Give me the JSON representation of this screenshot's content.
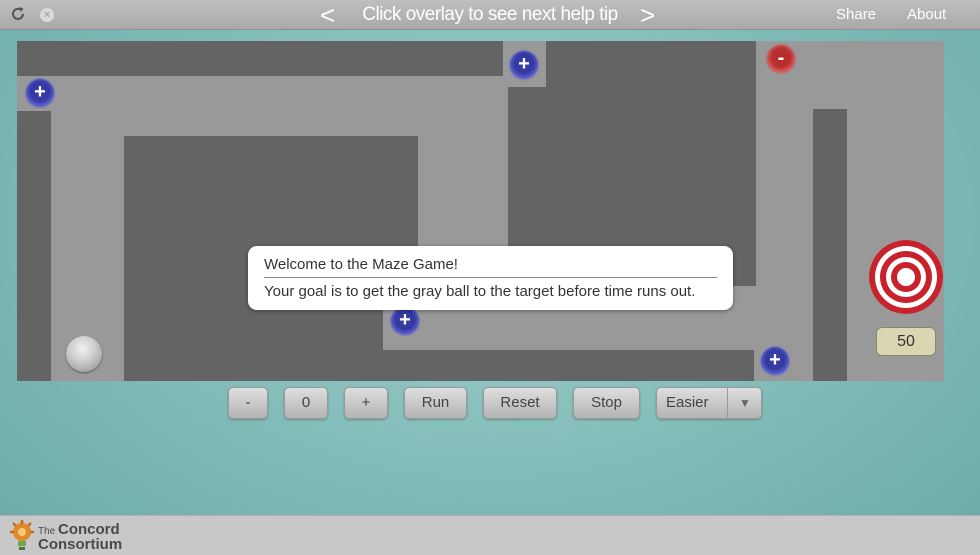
{
  "topbar": {
    "reload_icon": "reload-icon",
    "close_icon": "close-icon",
    "prev_label": "<",
    "next_label": ">",
    "help_text": "Click overlay to see next help tip",
    "share_label": "Share",
    "about_label": "About"
  },
  "maze": {
    "tokens": [
      "+",
      "+",
      "-",
      "+",
      "+"
    ],
    "timer_value": "50"
  },
  "popup": {
    "title": "Welcome to the Maze Game!",
    "body": "Your goal is to get the gray ball to the target before time runs out."
  },
  "controls": {
    "minus_label": "-",
    "value_label": "0",
    "plus_label": "+",
    "run_label": "Run",
    "reset_label": "Reset",
    "stop_label": "Stop",
    "difficulty_selected": "Easier"
  },
  "footer": {
    "logo_line1": "The",
    "logo_line2": "Concord",
    "logo_line3": "Consortium"
  },
  "colors": {
    "background": "#86bfbb",
    "wall": "#646464",
    "floor": "#999999",
    "token_blue": "#3b3fa8",
    "token_red": "#b83030",
    "target_red": "#c8232c"
  }
}
